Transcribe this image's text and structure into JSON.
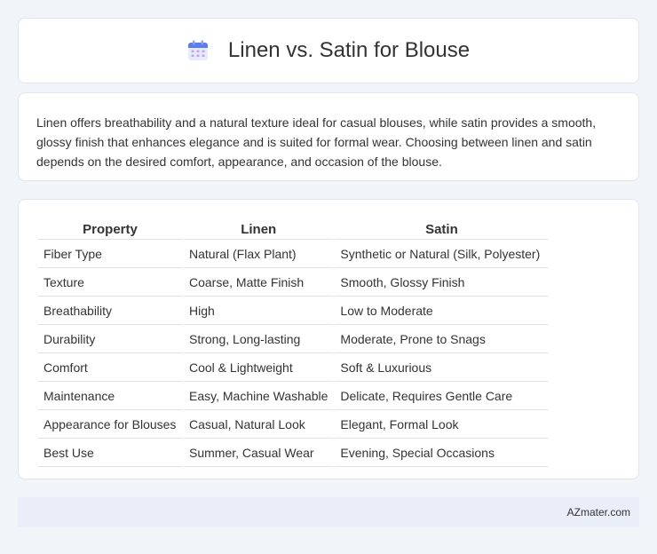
{
  "header": {
    "title": "Linen vs. Satin for Blouse",
    "icon": "calendar-icon"
  },
  "intro": {
    "text": "Linen offers breathability and a natural texture ideal for casual blouses, while satin provides a smooth, glossy finish that enhances elegance and is suited for formal wear. Choosing between linen and satin depends on the desired comfort, appearance, and occasion of the blouse."
  },
  "table": {
    "headers": [
      "Property",
      "Linen",
      "Satin"
    ],
    "rows": [
      [
        "Fiber Type",
        "Natural (Flax Plant)",
        "Synthetic or Natural (Silk, Polyester)"
      ],
      [
        "Texture",
        "Coarse, Matte Finish",
        "Smooth, Glossy Finish"
      ],
      [
        "Breathability",
        "High",
        "Low to Moderate"
      ],
      [
        "Durability",
        "Strong, Long-lasting",
        "Moderate, Prone to Snags"
      ],
      [
        "Comfort",
        "Cool & Lightweight",
        "Soft & Luxurious"
      ],
      [
        "Maintenance",
        "Easy, Machine Washable",
        "Delicate, Requires Gentle Care"
      ],
      [
        "Appearance for Blouses",
        "Casual, Natural Look",
        "Elegant, Formal Look"
      ],
      [
        "Best Use",
        "Summer, Casual Wear",
        "Evening, Special Occasions"
      ]
    ]
  },
  "footer": {
    "site": "AZmater.com"
  }
}
